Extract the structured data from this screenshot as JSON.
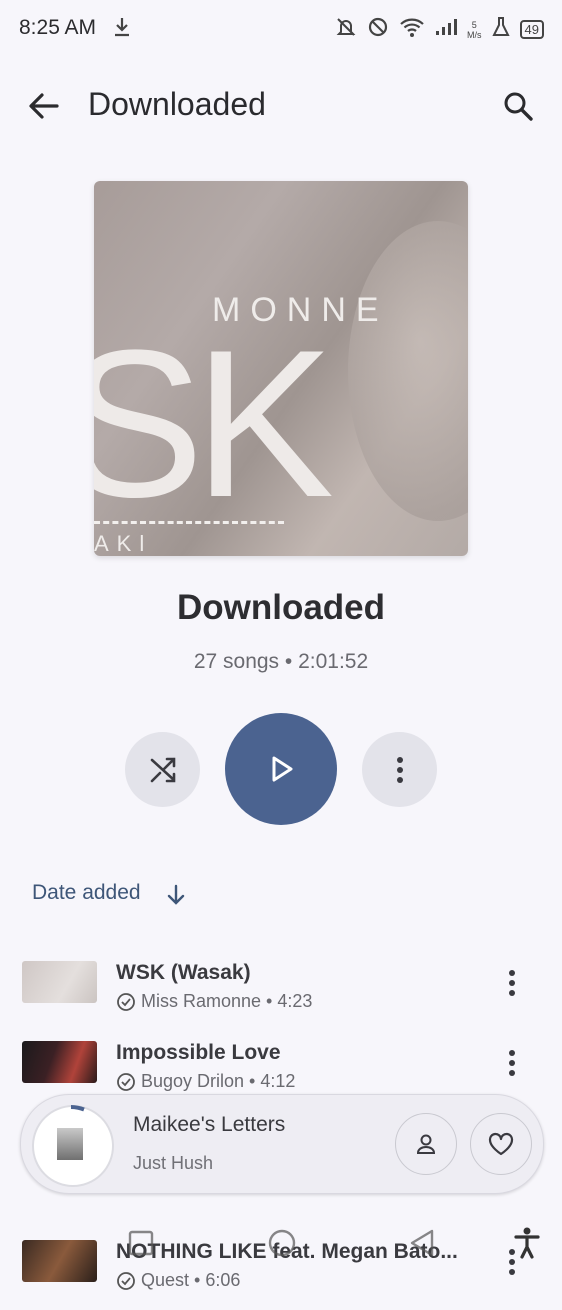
{
  "status_bar": {
    "time": "8:25 AM",
    "net_speed_value": "5",
    "net_speed_unit": "M/s",
    "battery": "49"
  },
  "header": {
    "title": "Downloaded"
  },
  "album_art": {
    "text_top": "MONNE",
    "text_big": "SK",
    "text_bottom": "AKl"
  },
  "playlist": {
    "name": "Downloaded",
    "info": "27 songs • 2:01:52"
  },
  "sort": {
    "label": "Date added"
  },
  "songs": [
    {
      "title": "WSK (Wasak)",
      "artist_duration": "Miss Ramonne • 4:23"
    },
    {
      "title": "Impossible Love",
      "artist_duration": "Bugoy Drilon • 4:12"
    },
    {
      "title": "NOTHING LIKE feat. Megan Bato...",
      "artist_duration": "Quest • 6:06"
    }
  ],
  "now_playing": {
    "title": "Maikee's Letters",
    "artist": "Just Hush"
  },
  "colors": {
    "accent": "#4b6390",
    "background": "#f7f6fb"
  }
}
